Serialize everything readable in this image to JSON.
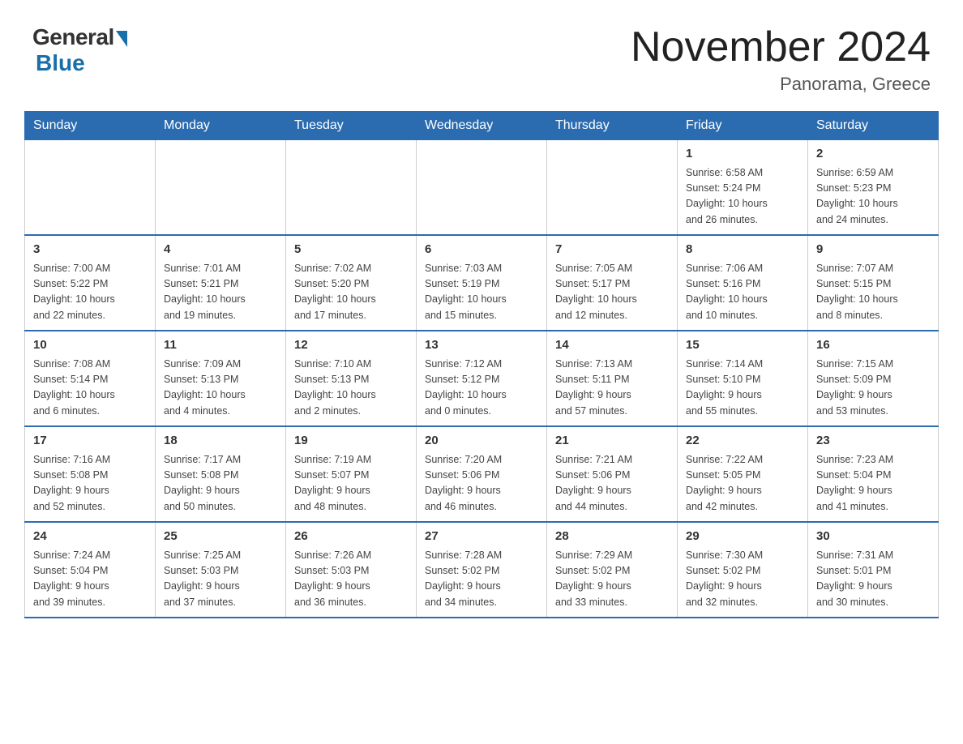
{
  "header": {
    "logo_general": "General",
    "logo_blue": "Blue",
    "month_year": "November 2024",
    "location": "Panorama, Greece"
  },
  "weekdays": [
    "Sunday",
    "Monday",
    "Tuesday",
    "Wednesday",
    "Thursday",
    "Friday",
    "Saturday"
  ],
  "weeks": [
    {
      "days": [
        {
          "num": "",
          "info": ""
        },
        {
          "num": "",
          "info": ""
        },
        {
          "num": "",
          "info": ""
        },
        {
          "num": "",
          "info": ""
        },
        {
          "num": "",
          "info": ""
        },
        {
          "num": "1",
          "info": "Sunrise: 6:58 AM\nSunset: 5:24 PM\nDaylight: 10 hours\nand 26 minutes."
        },
        {
          "num": "2",
          "info": "Sunrise: 6:59 AM\nSunset: 5:23 PM\nDaylight: 10 hours\nand 24 minutes."
        }
      ]
    },
    {
      "days": [
        {
          "num": "3",
          "info": "Sunrise: 7:00 AM\nSunset: 5:22 PM\nDaylight: 10 hours\nand 22 minutes."
        },
        {
          "num": "4",
          "info": "Sunrise: 7:01 AM\nSunset: 5:21 PM\nDaylight: 10 hours\nand 19 minutes."
        },
        {
          "num": "5",
          "info": "Sunrise: 7:02 AM\nSunset: 5:20 PM\nDaylight: 10 hours\nand 17 minutes."
        },
        {
          "num": "6",
          "info": "Sunrise: 7:03 AM\nSunset: 5:19 PM\nDaylight: 10 hours\nand 15 minutes."
        },
        {
          "num": "7",
          "info": "Sunrise: 7:05 AM\nSunset: 5:17 PM\nDaylight: 10 hours\nand 12 minutes."
        },
        {
          "num": "8",
          "info": "Sunrise: 7:06 AM\nSunset: 5:16 PM\nDaylight: 10 hours\nand 10 minutes."
        },
        {
          "num": "9",
          "info": "Sunrise: 7:07 AM\nSunset: 5:15 PM\nDaylight: 10 hours\nand 8 minutes."
        }
      ]
    },
    {
      "days": [
        {
          "num": "10",
          "info": "Sunrise: 7:08 AM\nSunset: 5:14 PM\nDaylight: 10 hours\nand 6 minutes."
        },
        {
          "num": "11",
          "info": "Sunrise: 7:09 AM\nSunset: 5:13 PM\nDaylight: 10 hours\nand 4 minutes."
        },
        {
          "num": "12",
          "info": "Sunrise: 7:10 AM\nSunset: 5:13 PM\nDaylight: 10 hours\nand 2 minutes."
        },
        {
          "num": "13",
          "info": "Sunrise: 7:12 AM\nSunset: 5:12 PM\nDaylight: 10 hours\nand 0 minutes."
        },
        {
          "num": "14",
          "info": "Sunrise: 7:13 AM\nSunset: 5:11 PM\nDaylight: 9 hours\nand 57 minutes."
        },
        {
          "num": "15",
          "info": "Sunrise: 7:14 AM\nSunset: 5:10 PM\nDaylight: 9 hours\nand 55 minutes."
        },
        {
          "num": "16",
          "info": "Sunrise: 7:15 AM\nSunset: 5:09 PM\nDaylight: 9 hours\nand 53 minutes."
        }
      ]
    },
    {
      "days": [
        {
          "num": "17",
          "info": "Sunrise: 7:16 AM\nSunset: 5:08 PM\nDaylight: 9 hours\nand 52 minutes."
        },
        {
          "num": "18",
          "info": "Sunrise: 7:17 AM\nSunset: 5:08 PM\nDaylight: 9 hours\nand 50 minutes."
        },
        {
          "num": "19",
          "info": "Sunrise: 7:19 AM\nSunset: 5:07 PM\nDaylight: 9 hours\nand 48 minutes."
        },
        {
          "num": "20",
          "info": "Sunrise: 7:20 AM\nSunset: 5:06 PM\nDaylight: 9 hours\nand 46 minutes."
        },
        {
          "num": "21",
          "info": "Sunrise: 7:21 AM\nSunset: 5:06 PM\nDaylight: 9 hours\nand 44 minutes."
        },
        {
          "num": "22",
          "info": "Sunrise: 7:22 AM\nSunset: 5:05 PM\nDaylight: 9 hours\nand 42 minutes."
        },
        {
          "num": "23",
          "info": "Sunrise: 7:23 AM\nSunset: 5:04 PM\nDaylight: 9 hours\nand 41 minutes."
        }
      ]
    },
    {
      "days": [
        {
          "num": "24",
          "info": "Sunrise: 7:24 AM\nSunset: 5:04 PM\nDaylight: 9 hours\nand 39 minutes."
        },
        {
          "num": "25",
          "info": "Sunrise: 7:25 AM\nSunset: 5:03 PM\nDaylight: 9 hours\nand 37 minutes."
        },
        {
          "num": "26",
          "info": "Sunrise: 7:26 AM\nSunset: 5:03 PM\nDaylight: 9 hours\nand 36 minutes."
        },
        {
          "num": "27",
          "info": "Sunrise: 7:28 AM\nSunset: 5:02 PM\nDaylight: 9 hours\nand 34 minutes."
        },
        {
          "num": "28",
          "info": "Sunrise: 7:29 AM\nSunset: 5:02 PM\nDaylight: 9 hours\nand 33 minutes."
        },
        {
          "num": "29",
          "info": "Sunrise: 7:30 AM\nSunset: 5:02 PM\nDaylight: 9 hours\nand 32 minutes."
        },
        {
          "num": "30",
          "info": "Sunrise: 7:31 AM\nSunset: 5:01 PM\nDaylight: 9 hours\nand 30 minutes."
        }
      ]
    }
  ]
}
